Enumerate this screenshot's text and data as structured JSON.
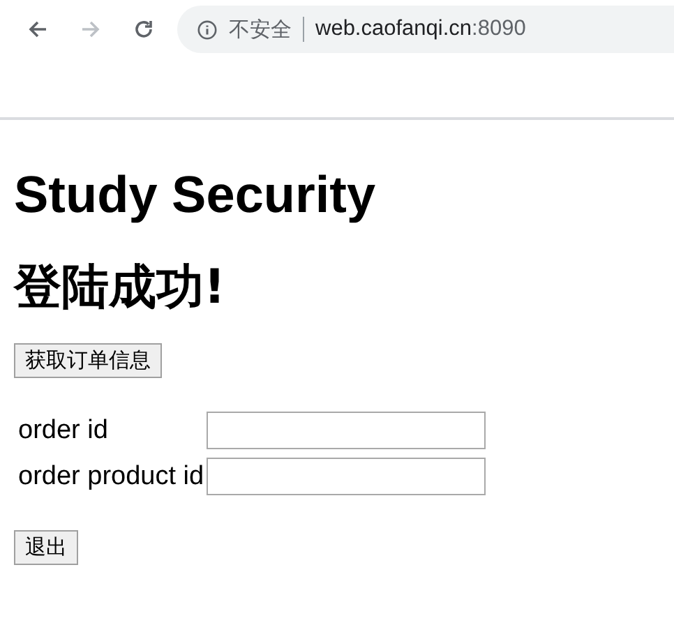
{
  "browser": {
    "security_label": "不安全",
    "url_host": "web.caofanqi.cn",
    "url_port": ":8090"
  },
  "page": {
    "title": "Study Security",
    "subtitle": "登陆成功!",
    "fetch_button": "获取订单信息",
    "fields": [
      {
        "label": "order id"
      },
      {
        "label": "order product id"
      }
    ],
    "logout_button": "退出"
  }
}
